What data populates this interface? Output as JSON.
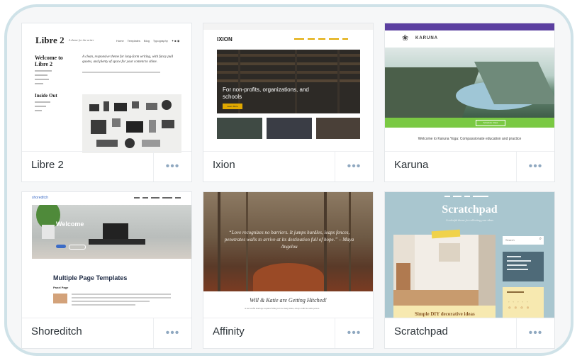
{
  "themes": [
    {
      "name": "Libre 2",
      "more_label": "•••",
      "preview": {
        "logo": "Libre 2",
        "tagline": "A theme for the writer",
        "nav": [
          "Home",
          "Templates",
          "Blog",
          "Typography"
        ],
        "sidebar_title": "Welcome to Libre 2",
        "intro": "A clean, responsive theme for long-form writing, with fancy pull quotes, and plenty of space for your content to shine.",
        "sidebar_title_2": "Inside Out"
      }
    },
    {
      "name": "Ixion",
      "more_label": "•••",
      "preview": {
        "logo": "IXION",
        "headline": "For non-profits, organizations, and schools",
        "cta": "Learn More"
      }
    },
    {
      "name": "Karuna",
      "more_label": "•••",
      "preview": {
        "logo": "KARUNA",
        "banner": "Schedule Class",
        "welcome": "Welcome to Karuna Yoga: Compassionate education and practice"
      }
    },
    {
      "name": "Shoreditch",
      "more_label": "•••",
      "preview": {
        "logo": "shoreditch",
        "hero_title": "Welcome",
        "section_title": "Multiple Page Templates",
        "subsection": "Panel Page"
      }
    },
    {
      "name": "Affinity",
      "more_label": "•••",
      "preview": {
        "quote": "“Love recognizes no barriers. It jumps hurdles, leaps fences, penetrates walls to arrive at its destination full of hope.” – Maya Angelou",
        "headline": "Will & Katie are Getting Hitched!",
        "sub": "A successful marriage requires falling in love many times, always with the same person."
      }
    },
    {
      "name": "Scratchpad",
      "more_label": "•••",
      "preview": {
        "logo": "Scratchpad",
        "tagline": "A colorful theme for collecting your ideas",
        "search": "Search",
        "caption": "Simple DIY decorative ideas"
      }
    }
  ],
  "colors": {
    "frame_border": "#cfe2e8",
    "more_dots": "#8fa8c0",
    "karuna_green": "#7ac943",
    "karuna_purple": "#5b3fa0",
    "scratchpad_blue": "#a9c6cf"
  }
}
